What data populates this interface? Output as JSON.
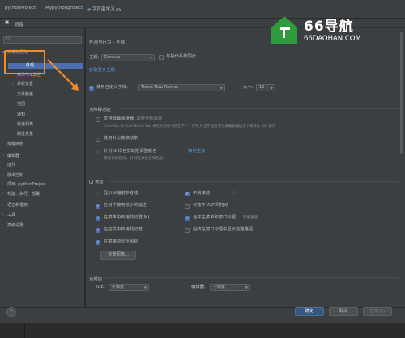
{
  "topbar": {
    "project": "pythonProject",
    "path": "Mypythonproject",
    "file": "字符串学习.py"
  },
  "window": {
    "title": "设置",
    "search_placeholder": "Q"
  },
  "sidebar": {
    "items": [
      {
        "label": "外观与行为",
        "expanded": true
      },
      {
        "label": "外观",
        "selected": true
      },
      {
        "label": "菜单与工具栏"
      },
      {
        "label": "系统设置"
      },
      {
        "label": "文件颜色"
      },
      {
        "label": "范围"
      },
      {
        "label": "通知"
      },
      {
        "label": "快速列表"
      },
      {
        "label": "路径变量"
      },
      {
        "label": "按键映射"
      },
      {
        "label": "编辑器"
      },
      {
        "label": "插件"
      },
      {
        "label": "版本控制"
      },
      {
        "label": "项目: pythonProject"
      },
      {
        "label": "构建、执行、部署"
      },
      {
        "label": "语言和框架"
      },
      {
        "label": "工具"
      },
      {
        "label": "高级设置"
      }
    ]
  },
  "main": {
    "breadcrumb": [
      "外观与行为",
      "外观"
    ],
    "theme_label": "主题:",
    "theme_value": "Darcula",
    "sync_label": "与操作系统同步",
    "more_themes": "获取更多主题",
    "custom_font_label": "使用自定义字体:",
    "font_value": "Times New Roman",
    "size_label": "大小:",
    "size_value": "12",
    "accessibility": {
      "title": "无障碍功能",
      "screen_reader": "支持屏幕阅读器",
      "screen_reader_note": "需要重新启动",
      "screen_reader_desc": "Ctrl+Tab 和 Ctrl+Shift+Tab 将在对话框中移至下一个控件,并且不能用于切换编辑器选项卡和其他 IDE 操作",
      "contrast_scrollbars": "使用对比度滚动条",
      "color_deficiency": "针对红-绿色觉缺陷调整颜色",
      "how_it_works": "如何生效",
      "color_deficiency_note": "需要重新启动。针对红绿色盲和色弱。"
    },
    "ui_options": {
      "title": "UI 选项",
      "left": [
        "显示树缩进参考线",
        "在树中使用较小的缩进",
        "在菜单中启用助记键(M)",
        "在控件中启用助记键",
        "在菜单项显示图标"
      ],
      "left_checked": [
        false,
        true,
        true,
        true,
        true
      ],
      "right": [
        "平滑滚动",
        "仅按下 ALT 时拖动",
        "合并主菜单和窗口标题",
        "始终在窗口标题中显示完整路径"
      ],
      "right_checked": [
        true,
        false,
        true,
        false
      ],
      "right_note": "需要重启",
      "bg_button": "背景图像..."
    },
    "antialias": {
      "title": "抗锯齿",
      "ide_label": "IDE:",
      "ide_value": "子像素",
      "editor_label": "编辑器:",
      "editor_value": "子像素"
    }
  },
  "footer": {
    "help": "?",
    "ok": "确定",
    "cancel": "取消",
    "apply": "应用(A)"
  },
  "watermark": {
    "brand": "66导航",
    "url": "66DAOHAN.COM"
  },
  "colors": {
    "accent": "#4b6eaf",
    "highlight": "#f28d2a",
    "link": "#589df6",
    "logo_green": "#2e9b3c"
  }
}
